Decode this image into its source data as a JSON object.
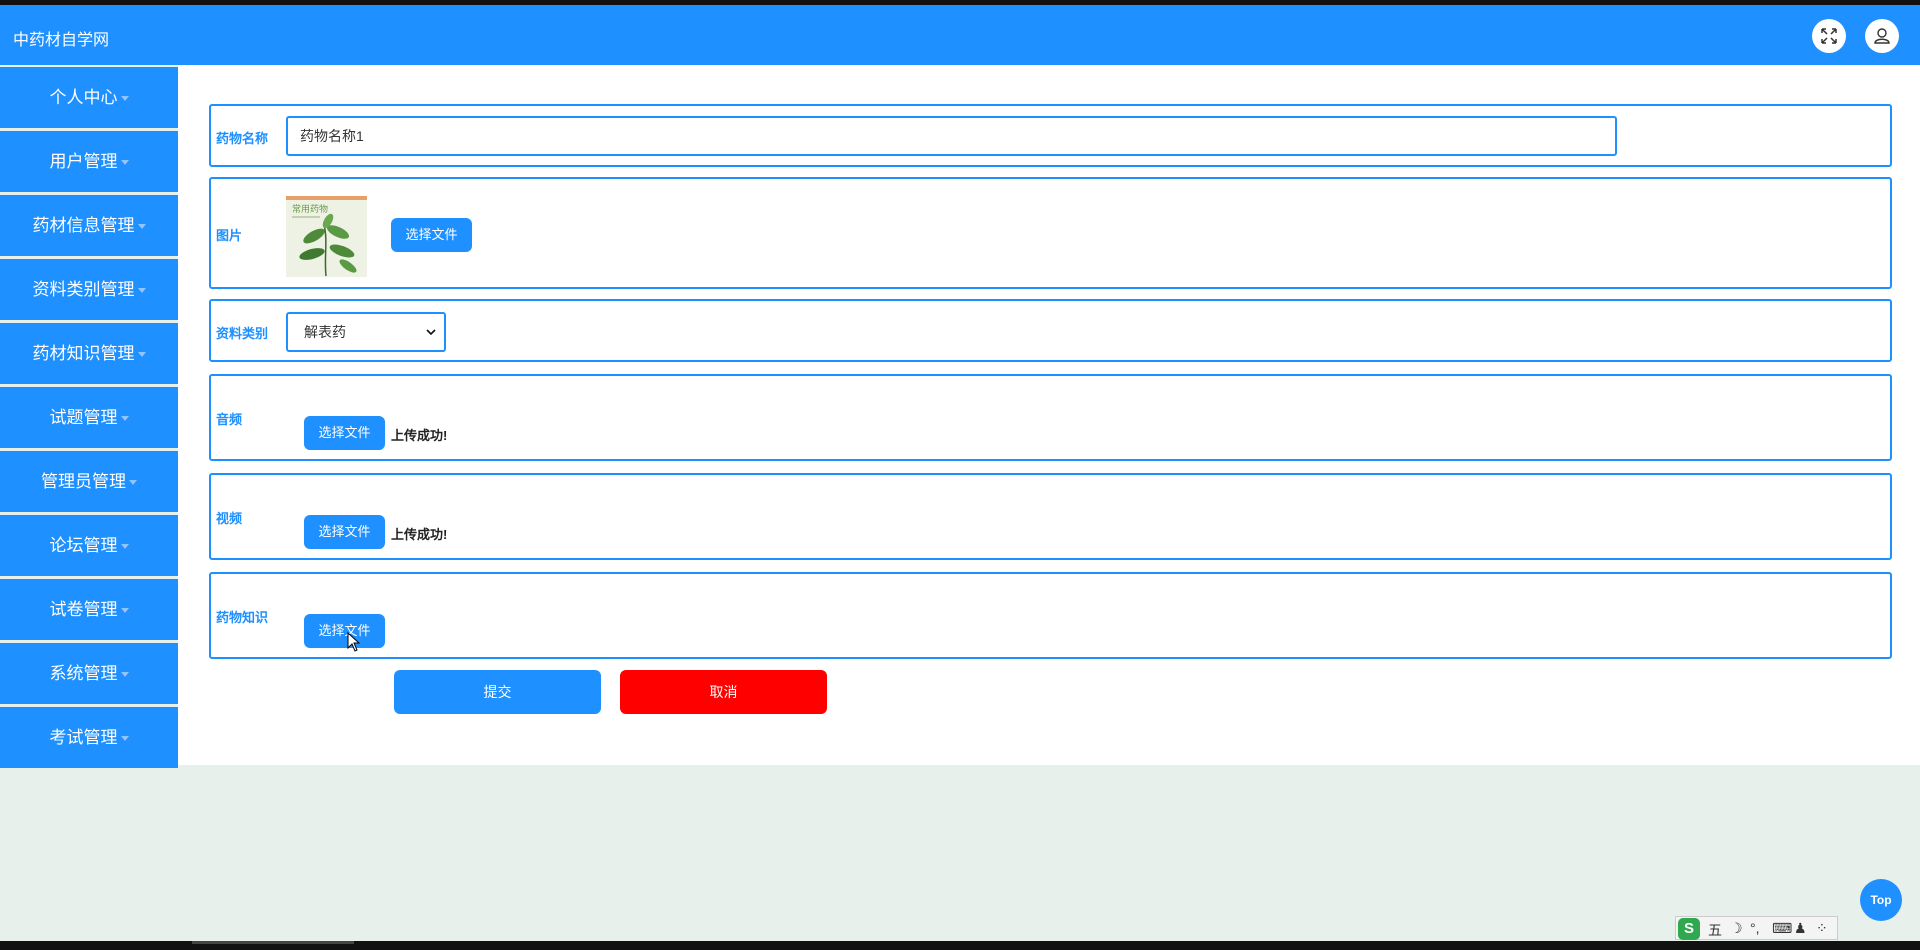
{
  "app": {
    "title": "中药材自学网"
  },
  "colors": {
    "primary": "#1e90ff",
    "danger": "#ff0000",
    "background": "#e8f0ec"
  },
  "header": {
    "fullscreen_icon": "fullscreen-icon",
    "user_icon": "user-icon"
  },
  "sidebar": {
    "items": [
      {
        "label": "个人中心"
      },
      {
        "label": "用户管理"
      },
      {
        "label": "药材信息管理"
      },
      {
        "label": "资料类别管理"
      },
      {
        "label": "药材知识管理"
      },
      {
        "label": "试题管理"
      },
      {
        "label": "管理员管理"
      },
      {
        "label": "论坛管理"
      },
      {
        "label": "试卷管理"
      },
      {
        "label": "系统管理"
      },
      {
        "label": "考试管理"
      }
    ]
  },
  "form": {
    "name": {
      "label": "药物名称",
      "value": "药物名称1"
    },
    "image": {
      "label": "图片",
      "button": "选择文件",
      "thumb_title": "常用药物"
    },
    "category": {
      "label": "资料类别",
      "selected": "解表药"
    },
    "audio": {
      "label": "音频",
      "button": "选择文件",
      "status": "上传成功!"
    },
    "video": {
      "label": "视频",
      "button": "选择文件",
      "status": "上传成功!"
    },
    "knowledge": {
      "label": "药物知识",
      "button": "选择文件"
    },
    "submit": "提交",
    "cancel": "取消"
  },
  "top_button": "Top",
  "ime": {
    "logo": "S",
    "mode": "五",
    "items": [
      "☽",
      "°,",
      "⌨",
      "♟",
      "⁘"
    ]
  }
}
